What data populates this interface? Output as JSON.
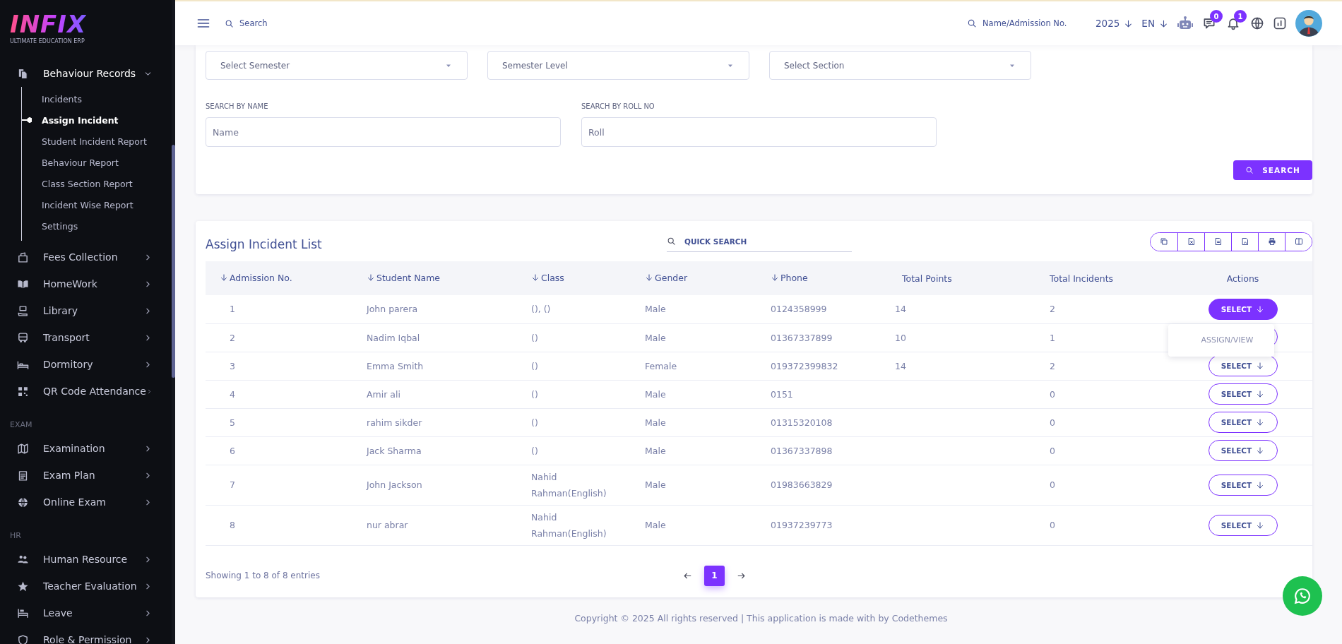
{
  "sidebar": {
    "logo": {
      "name": "INFIX",
      "tagline": "ULTIMATE EDUCATION ERP"
    },
    "sections": [
      {
        "items": [
          {
            "label": "Behaviour Records",
            "expanded": true,
            "children": [
              {
                "label": "Incidents",
                "selected": false
              },
              {
                "label": "Assign Incident",
                "selected": true
              },
              {
                "label": "Student Incident Report",
                "selected": false
              },
              {
                "label": "Behaviour Report",
                "selected": false
              },
              {
                "label": "Class Section Report",
                "selected": false
              },
              {
                "label": "Incident Wise Report",
                "selected": false
              },
              {
                "label": "Settings",
                "selected": false
              }
            ]
          },
          {
            "label": "Fees Collection",
            "expanded": false
          },
          {
            "label": "HomeWork",
            "expanded": false
          },
          {
            "label": "Library",
            "expanded": false
          },
          {
            "label": "Transport",
            "expanded": false
          },
          {
            "label": "Dormitory",
            "expanded": false
          },
          {
            "label": "QR Code Attendance",
            "expanded": false
          }
        ]
      },
      {
        "heading": "EXAM",
        "items": [
          {
            "label": "Examination",
            "expanded": false
          },
          {
            "label": "Exam Plan",
            "expanded": false
          },
          {
            "label": "Online Exam",
            "expanded": false
          }
        ]
      },
      {
        "heading": "HR",
        "items": [
          {
            "label": "Human Resource",
            "expanded": false
          },
          {
            "label": "Teacher Evaluation",
            "expanded": false
          },
          {
            "label": "Leave",
            "expanded": false
          },
          {
            "label": "Role & Permission",
            "expanded": false
          }
        ]
      }
    ]
  },
  "topbar": {
    "search": {
      "placeholder": "Search"
    },
    "student_search": {
      "placeholder": "Name/Admission No."
    },
    "year": "2025",
    "language": "EN",
    "messages_badge": "0",
    "notifications_badge": "1"
  },
  "filters": {
    "selects": [
      {
        "placeholder": "Select Semester"
      },
      {
        "placeholder": "Semester Level"
      },
      {
        "placeholder": "Select Section"
      }
    ],
    "fields": [
      {
        "label": "SEARCH BY NAME",
        "placeholder": "Name"
      },
      {
        "label": "SEARCH BY ROLL NO",
        "placeholder": "Roll"
      }
    ],
    "search_button": "SEARCH"
  },
  "table": {
    "title": "Assign Incident List",
    "quick_search": {
      "placeholder": "QUICK SEARCH"
    },
    "columns": [
      {
        "label": "Admission No.",
        "sortable": true
      },
      {
        "label": "Student Name",
        "sortable": true
      },
      {
        "label": "Class",
        "sortable": true
      },
      {
        "label": "Gender",
        "sortable": true
      },
      {
        "label": "Phone",
        "sortable": true
      },
      {
        "label": "Total Points",
        "sortable": false
      },
      {
        "label": "Total Incidents",
        "sortable": false
      },
      {
        "label": "Actions",
        "sortable": false
      }
    ],
    "rows": [
      {
        "admission_no": "1",
        "student_name": "John parera",
        "class": "(), ()",
        "gender": "Male",
        "phone": "0124358999",
        "total_points": "14",
        "total_incidents": "2",
        "action": {
          "label": "SELECT",
          "open": true,
          "menu": [
            "ASSIGN/VIEW"
          ]
        }
      },
      {
        "admission_no": "2",
        "student_name": "Nadim Iqbal",
        "class": "()",
        "gender": "Male",
        "phone": "01367337899",
        "total_points": "10",
        "total_incidents": "1",
        "action": {
          "open": false
        }
      },
      {
        "admission_no": "3",
        "student_name": "Emma Smith",
        "class": "()",
        "gender": "Female",
        "phone": "019372399832",
        "total_points": "14",
        "total_incidents": "2",
        "action": {
          "label": "SELECT",
          "open": false
        }
      },
      {
        "admission_no": "4",
        "student_name": "Amir ali",
        "class": "()",
        "gender": "Male",
        "phone": "0151",
        "total_incidents": "0",
        "action": {
          "label": "SELECT",
          "open": false
        }
      },
      {
        "admission_no": "5",
        "student_name": "rahim sikder",
        "class": "()",
        "gender": "Male",
        "phone": "01315320108",
        "total_incidents": "0",
        "action": {
          "label": "SELECT",
          "open": false
        }
      },
      {
        "admission_no": "6",
        "student_name": "Jack Sharma",
        "class": "()",
        "gender": "Male",
        "phone": "01367337898",
        "total_incidents": "0",
        "action": {
          "label": "SELECT",
          "open": false
        }
      },
      {
        "admission_no": "7",
        "student_name": "John Jackson",
        "class": "Nahid Rahman(English)",
        "gender": "Male",
        "phone": "01983663829",
        "total_incidents": "0",
        "action": {
          "label": "SELECT",
          "open": false
        }
      },
      {
        "admission_no": "8",
        "student_name": "nur abrar",
        "class": "Nahid Rahman(English)",
        "gender": "Male",
        "phone": "01937239773",
        "total_incidents": "0",
        "action": {
          "label": "SELECT",
          "open": false
        }
      }
    ],
    "summary": "Showing 1 to 8 of 8 entries",
    "pages": [
      {
        "label": "1",
        "selected": true
      }
    ]
  },
  "footer": {
    "copyright": "Copyright © 2025 All rights reserved | This application is made with by Codethemes"
  }
}
